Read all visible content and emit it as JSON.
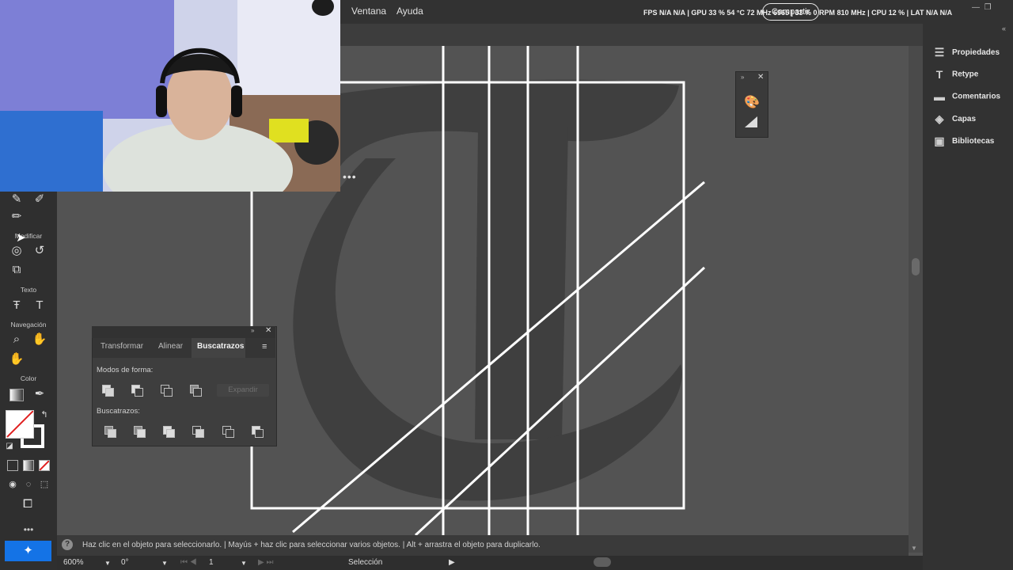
{
  "menu": {
    "ventana": "Ventana",
    "ayuda": "Ayuda"
  },
  "stats_overlay": "FPS N/A N/A | GPU 33 % 54 °C 72 MHz 6965 | 33 % 0 RPM 810 MHz | CPU 12 % | LAT N/A N/A",
  "share_label": "Compartir",
  "colors": {
    "accent": "#1473e6",
    "canvas": "#535353",
    "panel": "#323232"
  },
  "toolbar": {
    "modify_label": "Modificar",
    "text_label": "Texto",
    "nav_label": "Navegación",
    "color_label": "Color",
    "more_label": "•••"
  },
  "right_panel": {
    "items": [
      {
        "label": "Propiedades",
        "icon": "sliders-icon"
      },
      {
        "label": "Retype",
        "icon": "retype-icon"
      },
      {
        "label": "Comentarios",
        "icon": "comment-icon"
      },
      {
        "label": "Capas",
        "icon": "layers-icon"
      },
      {
        "label": "Bibliotecas",
        "icon": "libraries-icon"
      }
    ]
  },
  "pathfinder": {
    "tabs": [
      "Transformar",
      "Alinear",
      "Buscatrazos"
    ],
    "active_tab": "Buscatrazos",
    "shape_modes_label": "Modos de forma:",
    "pathfinders_label": "Buscatrazos:",
    "expand_label": "Expandir"
  },
  "status": {
    "help": "?",
    "hint": "Haz clic en el objeto para seleccionarlo. | Mayús + haz clic para seleccionar varios objetos. | Alt + arrastra el objeto para duplicarlo."
  },
  "bottom": {
    "zoom": "600%",
    "rotation": "0°",
    "artboard": "1",
    "tool": "Selección"
  },
  "overlay_dots": "•••"
}
